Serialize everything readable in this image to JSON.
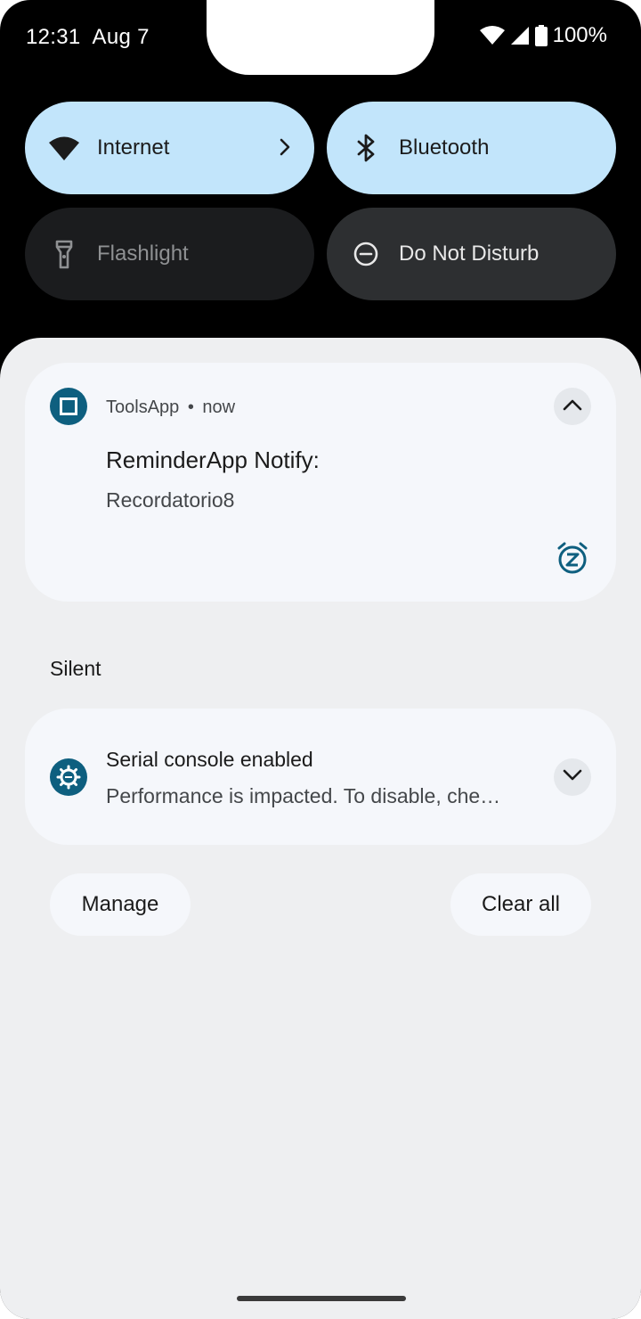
{
  "status_bar": {
    "time": "12:31",
    "date": "Aug 7",
    "battery": "100%"
  },
  "quick_settings": [
    {
      "label": "Internet",
      "icon": "wifi-icon",
      "state": "on"
    },
    {
      "label": "Bluetooth",
      "icon": "bluetooth-icon",
      "state": "on"
    },
    {
      "label": "Flashlight",
      "icon": "flashlight-icon",
      "state": "off"
    },
    {
      "label": "Do Not Disturb",
      "icon": "do-not-disturb-icon",
      "state": "off"
    }
  ],
  "notifications": [
    {
      "app": "ToolsApp",
      "separator": "•",
      "time": "now",
      "title": "ReminderApp Notify:",
      "text": "Recordatorio8",
      "expanded": true
    },
    {
      "title": "Serial console enabled",
      "text": "Performance is impacted. To disable, che…",
      "expanded": false
    }
  ],
  "silent_section": {
    "label": "Silent"
  },
  "actions": {
    "manage": "Manage",
    "clear_all": "Clear all"
  },
  "colors": {
    "tile_on": "#c2e5fb",
    "tile_off": "#1b1c1e",
    "accent": "#0e5f7f",
    "shade": "#eeeff1",
    "card": "#f5f7fb"
  }
}
